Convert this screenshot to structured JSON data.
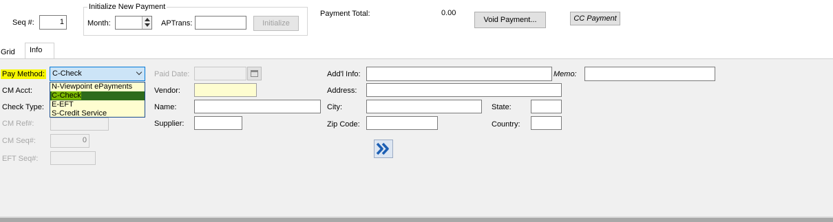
{
  "header": {
    "seq_label": "Seq #:",
    "seq_value": "1",
    "init_group_title": "Initialize New Payment",
    "month_label": "Month:",
    "month_value": "",
    "aptrans_label": "APTrans:",
    "aptrans_value": "",
    "initialize_label": "Initialize",
    "payment_total_label": "Payment Total:",
    "payment_total_value": "0.00",
    "void_payment_label": "Void Payment...",
    "cc_payment_label": "CC Payment"
  },
  "tabs": [
    {
      "label": "Grid"
    },
    {
      "label": "Info"
    }
  ],
  "form": {
    "pay_method_label": "Pay Method:",
    "pay_method_value": "C-Check",
    "pay_method_options": [
      "N-Viewpoint ePayments",
      "C-Check",
      "E-EFT",
      "S-Credit Service"
    ],
    "cm_acct_label": "CM Acct:",
    "check_type_label": "Check Type:",
    "cm_ref_label": "CM Ref#:",
    "cm_seq_label": "CM Seq#:",
    "cm_seq_value": "0",
    "eft_seq_label": "EFT Seq#:",
    "paid_date_label": "Paid Date:",
    "vendor_label": "Vendor:",
    "name_label": "Name:",
    "supplier_label": "Supplier:",
    "addl_info_label": "Add'l Info:",
    "memo_label": "Memo:",
    "address_label": "Address:",
    "city_label": "City:",
    "state_label": "State:",
    "zip_label": "Zip Code:",
    "country_label": "Country:"
  },
  "colors": {
    "highlight": "#f6f600",
    "form_background": "#f0f0f0",
    "selected_option": "#7ab800"
  },
  "icons": {
    "calendar": "calendar-icon",
    "forward": "double-chevron-right-icon"
  }
}
